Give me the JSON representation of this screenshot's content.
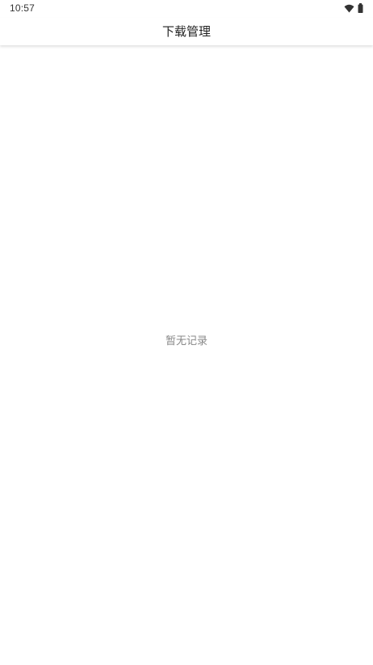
{
  "status_bar": {
    "time": "10:57",
    "icons": [
      "wifi-icon",
      "battery-icon"
    ]
  },
  "app_bar": {
    "title": "下载管理"
  },
  "content": {
    "empty_message": "暂无记录"
  },
  "colors": {
    "background": "#ffffff",
    "title_text": "#222222",
    "empty_text": "#888888"
  }
}
